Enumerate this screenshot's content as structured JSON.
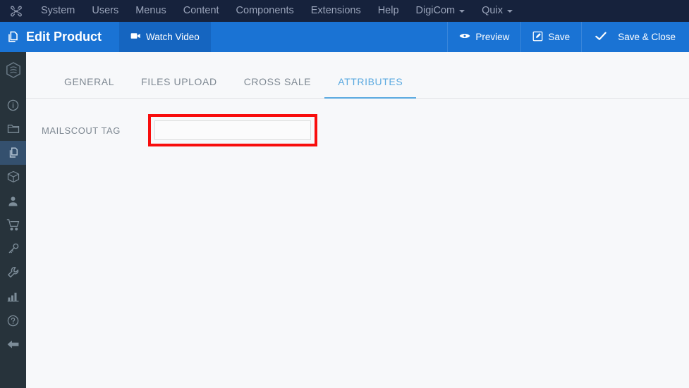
{
  "topnav": {
    "logo_icon": "joomla-logo-icon",
    "items": [
      {
        "label": "System",
        "caret": false
      },
      {
        "label": "Users",
        "caret": false
      },
      {
        "label": "Menus",
        "caret": false
      },
      {
        "label": "Content",
        "caret": false
      },
      {
        "label": "Components",
        "caret": false
      },
      {
        "label": "Extensions",
        "caret": false
      },
      {
        "label": "Help",
        "caret": false
      },
      {
        "label": "DigiCom",
        "caret": true
      },
      {
        "label": "Quix",
        "caret": true
      }
    ]
  },
  "toolbar": {
    "page_icon": "copy-pages-icon",
    "title": "Edit Product",
    "watch_video_label": "Watch Video",
    "watch_video_icon": "video-camera-icon",
    "preview_label": "Preview",
    "preview_icon": "eye-icon",
    "save_label": "Save",
    "save_icon": "edit-pencil-icon",
    "save_close_label": "Save & Close",
    "save_close_icon": "check-icon"
  },
  "sidebar": {
    "items": [
      {
        "icon": "shield-logo-icon",
        "label": "Dashboard",
        "active": false
      },
      {
        "icon": "info-circle-icon",
        "label": "Info",
        "active": false
      },
      {
        "icon": "folder-icon",
        "label": "Categories",
        "active": false
      },
      {
        "icon": "copy-pages-icon",
        "label": "Products",
        "active": true
      },
      {
        "icon": "box-package-icon",
        "label": "Packages",
        "active": false
      },
      {
        "icon": "user-icon",
        "label": "Customers",
        "active": false
      },
      {
        "icon": "shopping-cart-icon",
        "label": "Orders",
        "active": false
      },
      {
        "icon": "key-icon",
        "label": "Licenses",
        "active": false
      },
      {
        "icon": "wrench-icon",
        "label": "Tools",
        "active": false
      },
      {
        "icon": "bar-chart-icon",
        "label": "Reports",
        "active": false
      },
      {
        "icon": "question-circle-icon",
        "label": "Help",
        "active": false
      },
      {
        "icon": "back-arrow-icon",
        "label": "Back",
        "active": false
      }
    ]
  },
  "main": {
    "tabs": [
      {
        "label": "GENERAL",
        "active": false
      },
      {
        "label": "FILES UPLOAD",
        "active": false
      },
      {
        "label": "CROSS SALE",
        "active": false
      },
      {
        "label": "ATTRIBUTES",
        "active": true
      }
    ],
    "form": {
      "field_label": "MAILSCOUT TAG",
      "field_value": "",
      "field_placeholder": ""
    }
  },
  "colors": {
    "topnav_bg": "#16223c",
    "toolbar_bg": "#1a73d4",
    "toolbar_btn_darker": "#1565c0",
    "sidebar_bg": "#27333b",
    "sidebar_active": "#34506e",
    "page_bg": "#f7f8fa",
    "tab_active": "#5aa9e0",
    "highlight_red": "#f80d0d"
  }
}
